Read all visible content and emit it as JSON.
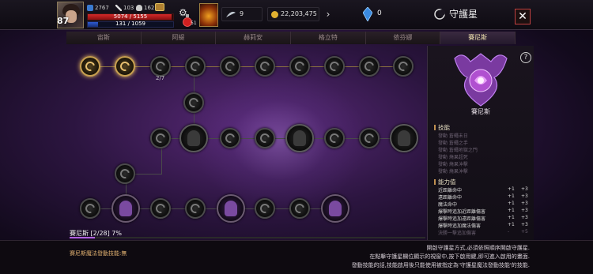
{
  "player": {
    "level": "87",
    "stat1": "2767",
    "stat2": "103",
    "stat3": "162",
    "hp_text": "5074 / 5155",
    "hp_fraction": 0.984,
    "mp_text": "131 / 1059",
    "mp_fraction": 0.124,
    "potion_count": "51"
  },
  "resources": {
    "feather": "9",
    "gold": "22,203,475",
    "crystal": "0"
  },
  "header": {
    "title": "守護星",
    "close": "✕"
  },
  "tabs": [
    "宙斯",
    "阿緹",
    "赫莉安",
    "格立特",
    "依芬娜",
    "賽尼斯"
  ],
  "active_tab": 5,
  "board": {
    "node_progress": "2/7",
    "footer": "賽尼斯 [2/28] 7%",
    "progress_fraction": 0.07
  },
  "panel": {
    "help": "?",
    "name": "賽尼斯",
    "skills_title": "技能",
    "skills": [
      "發動 蒼蠅未日",
      "發動 蒼蠅之手",
      "發動 蒼蠅地獄之門",
      "發動 燒果超死",
      "發動 燒果沖擊",
      "發動 燒果沖擊"
    ],
    "stats_title": "能力值",
    "stats": [
      {
        "name": "近距離命中",
        "a": "+1",
        "b": "+3"
      },
      {
        "name": "遠距離命中",
        "a": "+1",
        "b": "+3"
      },
      {
        "name": "魔法命中",
        "a": "+1",
        "b": "+3"
      },
      {
        "name": "爆擊時追加近距離傷害",
        "a": "+1",
        "b": "+3"
      },
      {
        "name": "爆擊時追加遠距離傷害",
        "a": "+1",
        "b": "+3"
      },
      {
        "name": "爆擊時追加魔法傷害",
        "a": "+1",
        "b": "+3"
      },
      {
        "name": "決勝一擊追加傷害",
        "a": "-",
        "b": "+5"
      }
    ]
  },
  "bottom": {
    "left_note": "賽尼斯魔法發動技能:無",
    "desc_lines": [
      "開啟守護星方式,必須依照順序開啟守護星.",
      "在點擊守護星欄位顯示的視窗中,按下啟用鍵,即可進入啟用的畫面.",
      "發動技能的話,技能啟用後只能使用被指定為'守護星魔法發動技能'的技能."
    ]
  }
}
